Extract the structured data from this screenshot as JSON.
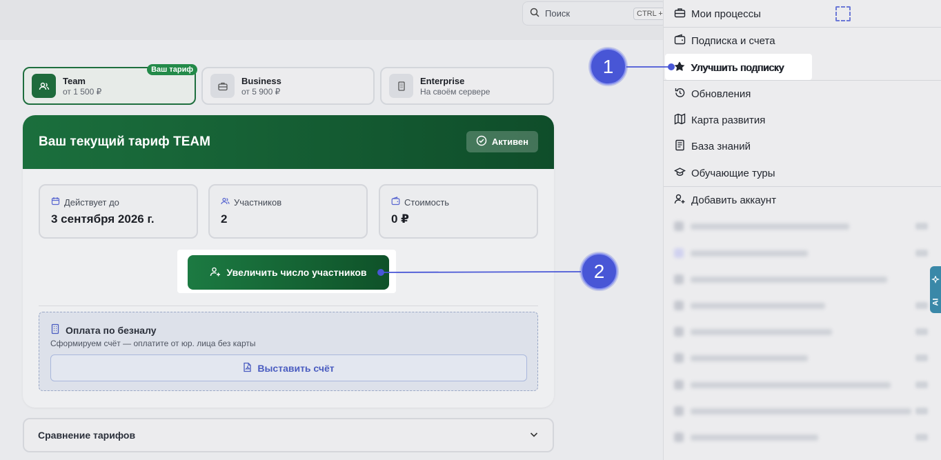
{
  "search": {
    "placeholder": "Поиск",
    "shortcut": "CTRL +"
  },
  "tariffs": [
    {
      "name": "Team",
      "price": "от 1 500 ₽",
      "badge": "Ваш тариф"
    },
    {
      "name": "Business",
      "price": "от 5 900 ₽"
    },
    {
      "name": "Enterprise",
      "price": "На своём сервере"
    }
  ],
  "card": {
    "title": "Ваш текущий тариф TEAM",
    "status": "Активен",
    "stats": [
      {
        "label": "Действует до",
        "value": "3 сентября 2026 г."
      },
      {
        "label": "Участников",
        "value": "2"
      },
      {
        "label": "Стоимость",
        "value": "0 ₽"
      }
    ],
    "add_button": "Увеличить число участников",
    "invoice": {
      "title": "Оплата по безналу",
      "description": "Сформируем счёт — оплатите от юр. лица без карты",
      "button": "Выставить счёт"
    }
  },
  "compare": {
    "label": "Сравнение тарифов"
  },
  "menu": {
    "items": [
      {
        "label": "Мои процессы",
        "icon": "briefcase-icon"
      },
      {
        "label": "Подписка и счета",
        "icon": "wallet-icon"
      },
      {
        "label": "Улучшить подписку",
        "icon": "star-icon"
      },
      {
        "label": "Обновления",
        "icon": "history-icon"
      },
      {
        "label": "Карта развития",
        "icon": "map-icon"
      },
      {
        "label": "База знаний",
        "icon": "book-icon"
      },
      {
        "label": "Обучающие туры",
        "icon": "graduation-cap-icon"
      },
      {
        "label": "Добавить аккаунт",
        "icon": "user-plus-icon"
      }
    ],
    "accounts_blurred": 9
  },
  "ai_tab": "AI",
  "callouts": [
    "1",
    "2"
  ],
  "colors": {
    "brand_green": "#1b6f3d",
    "callout": "#4856d6",
    "invoice_accent": "#4a5cc0"
  }
}
